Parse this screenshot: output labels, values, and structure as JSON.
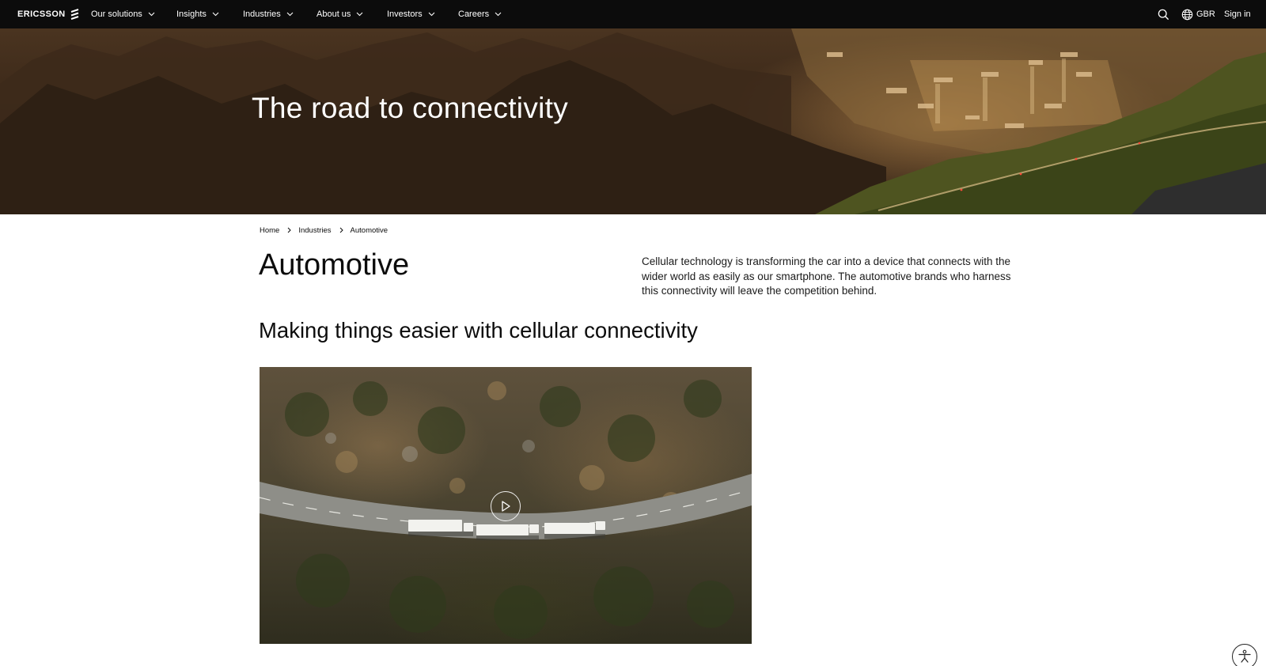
{
  "nav": {
    "logo_text": "ERICSSON",
    "items": [
      {
        "label": "Our solutions"
      },
      {
        "label": "Insights"
      },
      {
        "label": "Industries"
      },
      {
        "label": "About us"
      },
      {
        "label": "Investors"
      },
      {
        "label": "Careers"
      }
    ],
    "region_label": "GBR",
    "signin_label": "Sign in"
  },
  "hero": {
    "title": "The road to connectivity"
  },
  "breadcrumb": {
    "items": [
      "Home",
      "Industries",
      "Automotive"
    ]
  },
  "page": {
    "title": "Automotive",
    "intro": "Cellular technology is transforming the car into a device that connects with the wider world as easily as our smartphone. The automotive brands who harness this connectivity will leave the competition behind.",
    "section_title": "Making things easier with cellular connectivity"
  },
  "icons": {
    "logo": "ericsson-logo-icon",
    "dropdown": "chevron-down-icon",
    "search": "search-icon",
    "region": "globe-icon",
    "breadcrumb_sep": "chevron-right-icon",
    "play": "play-icon",
    "accessibility": "accessibility-icon"
  },
  "colors": {
    "nav_background": "#0c0c0c",
    "text": "#0c0c0c",
    "background": "#ffffff"
  }
}
